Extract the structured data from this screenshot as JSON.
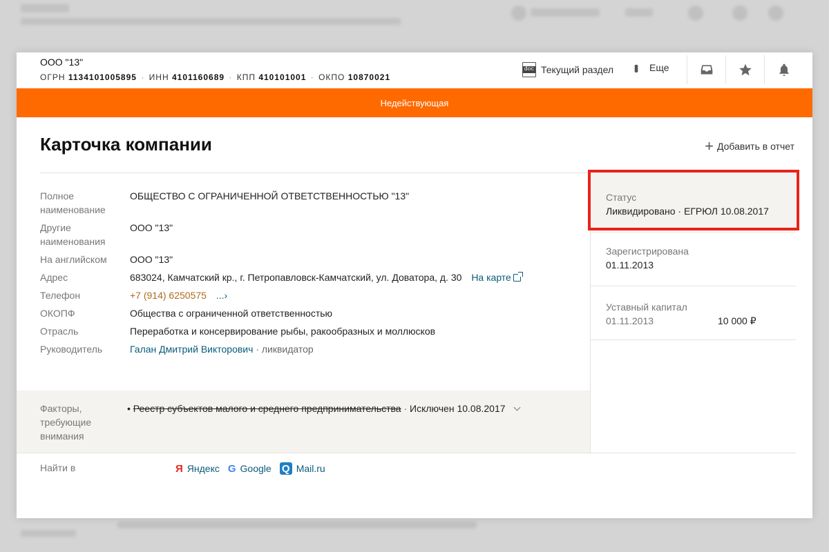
{
  "company": {
    "short_name": "ООО \"13\"",
    "codes": [
      {
        "label": "ОГРН",
        "value": "1134101005895"
      },
      {
        "label": "ИНН",
        "value": "4101160689"
      },
      {
        "label": "КПП",
        "value": "410101001"
      },
      {
        "label": "ОКПО",
        "value": "10870021"
      }
    ]
  },
  "toolbar": {
    "current_section_label": "Текущий раздел",
    "doc_icon_text": "doc",
    "more_label": "Еще"
  },
  "banner": {
    "text": "Недействующая",
    "color": "#ff6a00"
  },
  "page": {
    "title": "Карточка компании",
    "add_report_label": "Добавить в отчет"
  },
  "fields": [
    {
      "label": "Полное наименование",
      "value": "ОБЩЕСТВО С ОГРАНИЧЕННОЙ ОТВЕТСТВЕННОСТЬЮ \"13\""
    },
    {
      "label": "Другие наименования",
      "value": "ООО \"13\""
    },
    {
      "label": "На английском",
      "value": "ООО \"13\""
    },
    {
      "label": "Адрес",
      "value": "683024, Камчатский кр., г. Петропавловск-Камчатский, ул. Доватора, д. 30",
      "link": "На карте"
    },
    {
      "label": "Телефон",
      "value": "+7 (914) 6250575",
      "more": "..."
    },
    {
      "label": "ОКОПФ",
      "value": "Общества с ограниченной ответственностью"
    },
    {
      "label": "Отрасль",
      "value": "Переработка и консервирование рыбы, ракообразных и моллюсков"
    },
    {
      "label": "Руководитель",
      "value": "Галан Дмитрий Викторович",
      "role": "ликвидатор"
    }
  ],
  "factors": {
    "label": "Факторы, требующие внимания",
    "item_strike": "Реестр субъектов малого и среднего предпринимательства",
    "item_suffix": "Исключен 10.08.2017"
  },
  "find_in": {
    "label": "Найти в",
    "links": [
      {
        "glyph": "Я",
        "label": "Яндекс"
      },
      {
        "glyph": "G",
        "label": "Google"
      },
      {
        "glyph": "Q",
        "label": "Mail.ru"
      }
    ]
  },
  "side": {
    "status": {
      "label": "Статус",
      "value": "Ликвидировано · ЕГРЮЛ 10.08.2017"
    },
    "registered": {
      "label": "Зарегистрирована",
      "value": "01.11.2013"
    },
    "capital": {
      "label": "Уставный капитал",
      "date": "01.11.2013",
      "amount": "10 000 ₽"
    }
  },
  "colors": {
    "status_red": "#a51c1c",
    "highlight": "#e8231a",
    "link": "#0b5b7a"
  }
}
